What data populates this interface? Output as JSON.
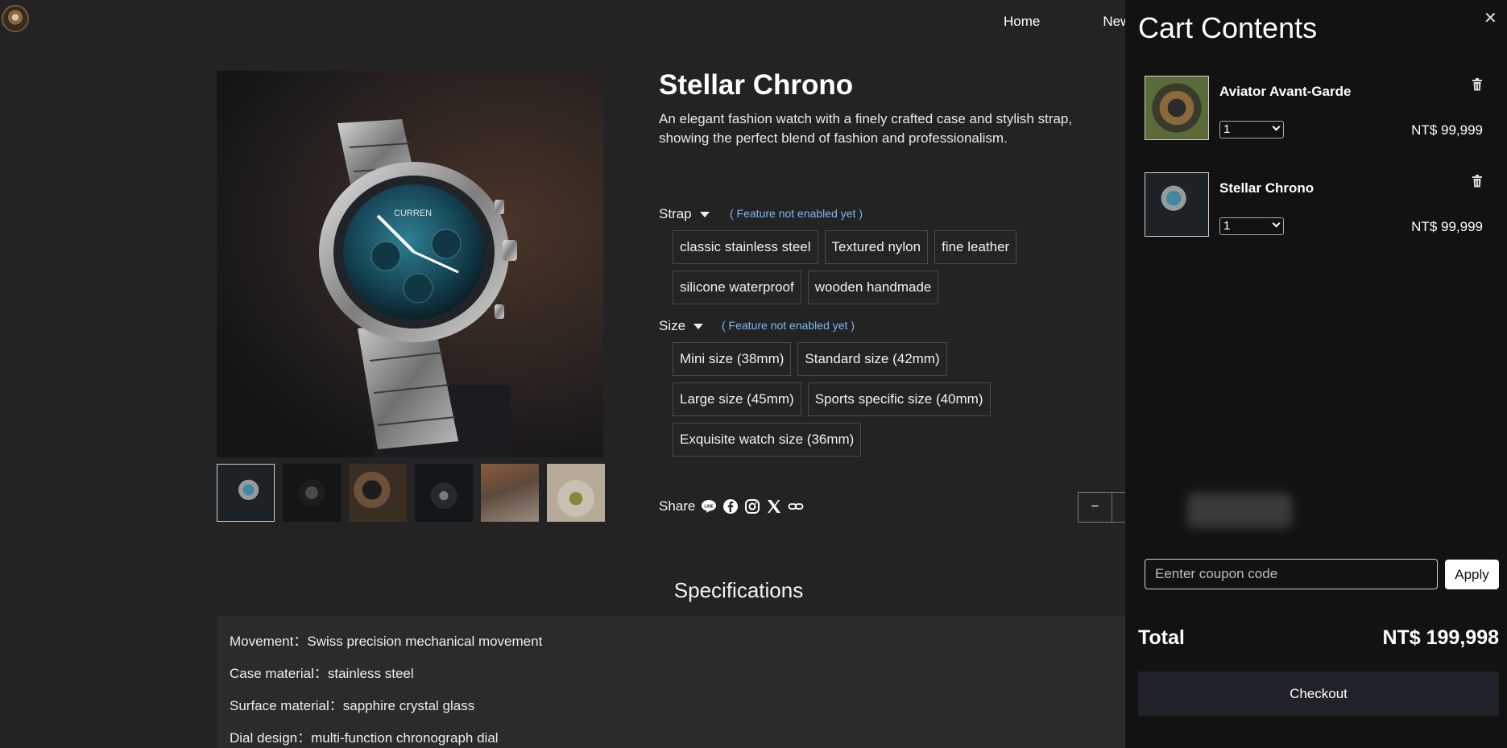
{
  "nav": {
    "items": [
      "Home",
      "New"
    ]
  },
  "product": {
    "title": "Stellar Chrono",
    "description": "An elegant fashion watch with a finely crafted case and stylish strap, showing the perfect blend of fashion and professionalism.",
    "strap_label": "Strap",
    "strap_note": "( Feature not enabled yet )",
    "strap_options": [
      "classic stainless steel",
      "Textured nylon",
      "fine leather",
      "silicone waterproof",
      "wooden handmade"
    ],
    "size_label": "Size",
    "size_note": "( Feature not enabled yet )",
    "size_options": [
      "Mini size (38mm)",
      "Standard size (42mm)",
      "Large size (45mm)",
      "Sports specific size (40mm)",
      "Exquisite watch size (36mm)"
    ],
    "share_label": "Share",
    "share_icons": [
      "line-icon",
      "facebook-icon",
      "instagram-icon",
      "x-icon",
      "link-icon"
    ],
    "qty_minus": "−"
  },
  "specs": {
    "title": "Specifications",
    "rows": [
      "Movement：Swiss precision mechanical movement",
      "Case material：stainless steel",
      "Surface material：sapphire crystal glass",
      "Dial design：multi-function chronograph dial"
    ]
  },
  "cart": {
    "title": "Cart Contents",
    "close": "✕",
    "items": [
      {
        "name": "Aviator Avant-Garde",
        "qty": "1",
        "price": "NT$ 99,999"
      },
      {
        "name": "Stellar Chrono",
        "qty": "1",
        "price": "NT$ 99,999"
      }
    ],
    "coupon_placeholder": "Eenter coupon code",
    "apply_label": "Apply",
    "total_label": "Total",
    "total_value": "NT$ 199,998",
    "checkout_label": "Checkout"
  }
}
